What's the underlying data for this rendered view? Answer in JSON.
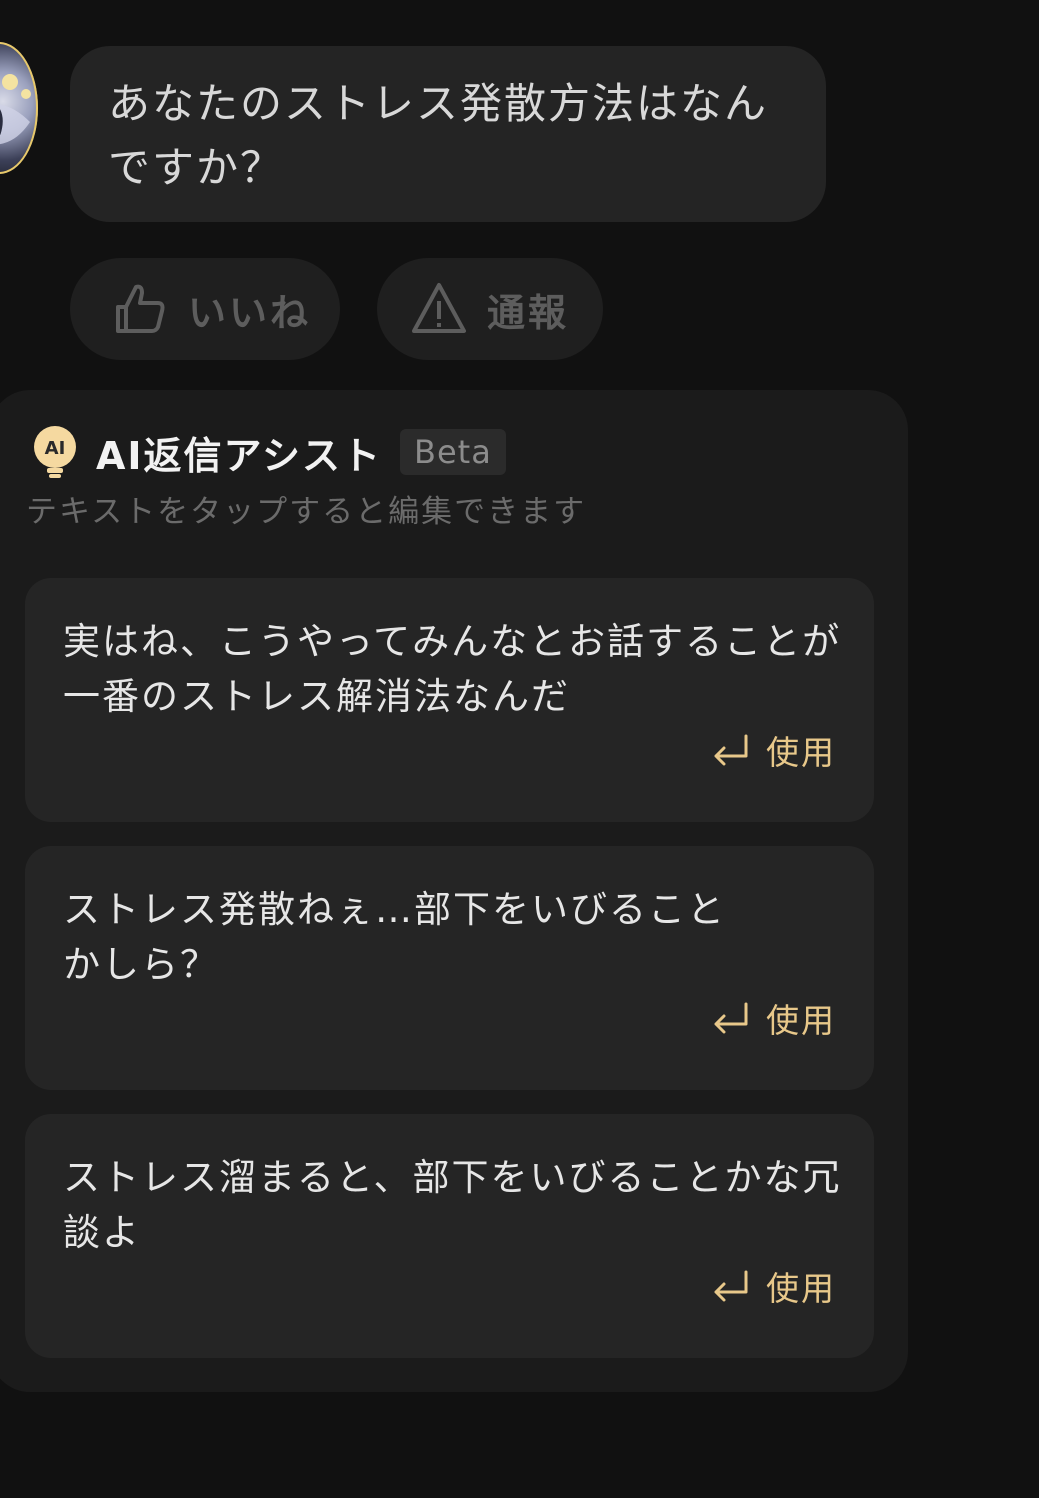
{
  "message": {
    "text": "あなたのストレス発散方法はなんですか？"
  },
  "reactions": {
    "like_label": "いいね",
    "report_label": "通報"
  },
  "assist": {
    "title": "AI返信アシスト",
    "badge": "Beta",
    "subtitle": "テキストをタップすると編集できます",
    "use_label": "使用",
    "suggestions": [
      {
        "text": "実はね、こうやってみんなとお話することが一番のストレス解消法なんだ"
      },
      {
        "text": "ストレス発散ねぇ…部下をいびることかしら？"
      },
      {
        "text": "ストレス溜まると、部下をいびることかな冗談よ"
      }
    ]
  },
  "colors": {
    "background": "#111111",
    "bubble": "#242424",
    "panel": "#1b1b1b",
    "card": "#252525",
    "accent": "#e8c88a",
    "bulb": "#f5d9a0"
  }
}
